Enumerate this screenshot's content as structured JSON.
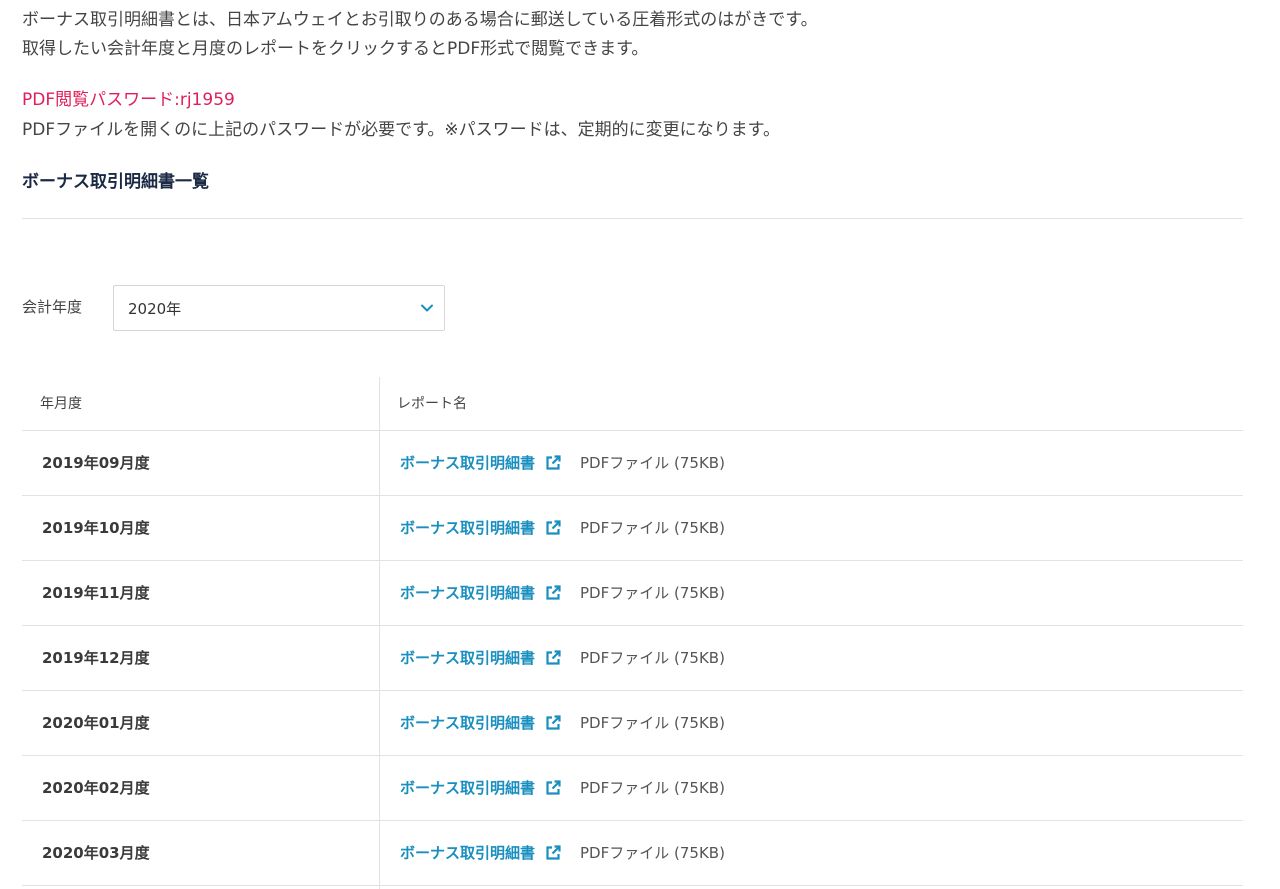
{
  "intro": {
    "line1": "ボーナス取引明細書とは、日本アムウェイとお引取りのある場合に郵送している圧着形式のはがきです。",
    "line2": "取得したい会計年度と月度のレポートをクリックするとPDF形式で閲覧できます。"
  },
  "password": {
    "text": "PDF閲覧パスワード:rj1959",
    "note": "PDFファイルを開くのに上記のパスワードが必要です。※パスワードは、定期的に変更になります。"
  },
  "section_title": "ボーナス取引明細書一覧",
  "filter": {
    "label": "会計年度",
    "selected": "2020年"
  },
  "table": {
    "headers": {
      "month": "年月度",
      "report": "レポート名"
    },
    "rows": [
      {
        "month": "2019年09月度",
        "report": "ボーナス取引明細書",
        "file": "PDFファイル (75KB)"
      },
      {
        "month": "2019年10月度",
        "report": "ボーナス取引明細書",
        "file": "PDFファイル (75KB)"
      },
      {
        "month": "2019年11月度",
        "report": "ボーナス取引明細書",
        "file": "PDFファイル (75KB)"
      },
      {
        "month": "2019年12月度",
        "report": "ボーナス取引明細書",
        "file": "PDFファイル (75KB)"
      },
      {
        "month": "2020年01月度",
        "report": "ボーナス取引明細書",
        "file": "PDFファイル (75KB)"
      },
      {
        "month": "2020年02月度",
        "report": "ボーナス取引明細書",
        "file": "PDFファイル (75KB)"
      },
      {
        "month": "2020年03月度",
        "report": "ボーナス取引明細書",
        "file": "PDFファイル (75KB)"
      }
    ]
  },
  "icons": {
    "select": "chevron-down-icon",
    "link": "external-link-icon"
  },
  "colors": {
    "accent": "#1a8fbf",
    "password": "#e01e5a",
    "title": "#1b2a44"
  }
}
